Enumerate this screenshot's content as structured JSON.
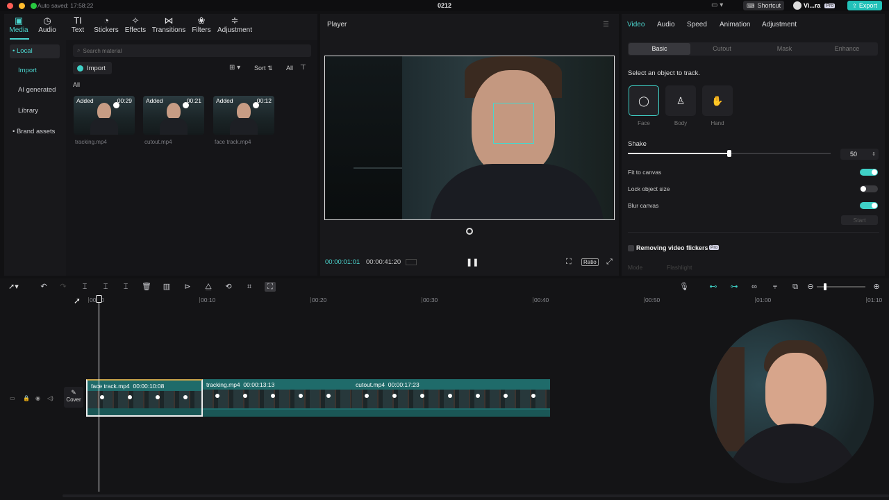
{
  "titlebar": {
    "autosave": "Auto saved: 17:58:22",
    "project": "0212",
    "shortcut": "Shortcut",
    "user": "Vi...ra",
    "pro": "Pro",
    "export": "Export"
  },
  "toolbar": [
    {
      "label": "Media",
      "icon": "▣",
      "name": "media-tab"
    },
    {
      "label": "Audio",
      "icon": "◷",
      "name": "audio-tab"
    },
    {
      "label": "Text",
      "icon": "TI",
      "name": "text-tab"
    },
    {
      "label": "Stickers",
      "icon": "◔",
      "name": "stickers-tab"
    },
    {
      "label": "Effects",
      "icon": "✧",
      "name": "effects-tab"
    },
    {
      "label": "Transitions",
      "icon": "⋈",
      "name": "transitions-tab"
    },
    {
      "label": "Filters",
      "icon": "❀",
      "name": "filters-tab"
    },
    {
      "label": "Adjustment",
      "icon": "≑",
      "name": "adjustment-tab"
    }
  ],
  "sidebar": {
    "local": "• Local",
    "import": "Import",
    "ai": "AI generated",
    "library": "Library",
    "brand": "• Brand assets"
  },
  "media": {
    "search_placeholder": "Search material",
    "import": "Import",
    "sort": "Sort",
    "all": "All",
    "section": "All",
    "items": [
      {
        "tag": "Added",
        "duration": "00:29",
        "name": "tracking.mp4"
      },
      {
        "tag": "Added",
        "duration": "00:21",
        "name": "cutout.mp4"
      },
      {
        "tag": "Added",
        "duration": "00:12",
        "name": "face track.mp4"
      }
    ]
  },
  "player": {
    "title": "Player",
    "current": "00:00:01:01",
    "total": "00:00:41:20",
    "ratio": "Ratio"
  },
  "props": {
    "tabs": [
      "Video",
      "Audio",
      "Speed",
      "Animation",
      "Adjustment"
    ],
    "subtabs": [
      "Basic",
      "Cutout",
      "Mask",
      "Enhance"
    ],
    "select_label": "Select an object to track.",
    "targets": [
      "Face",
      "Body",
      "Hand"
    ],
    "shake_label": "Shake",
    "shake_value": "50",
    "shake_level": 0.5,
    "fit": "Fit to canvas",
    "lock": "Lock object size",
    "blur": "Blur canvas",
    "start": "Start",
    "flicker": "Removing video flickers",
    "flicker_badge": "Pro",
    "mode": "Mode",
    "mode_value": "Flashlight"
  },
  "timeline": {
    "ruler": [
      "00:00",
      "00:10",
      "00:20",
      "00:30",
      "00:40",
      "00:50",
      "01:00",
      "01:10"
    ],
    "cover": "Cover",
    "clips": [
      {
        "name": "face track.mp4",
        "duration": "00:00:10:08"
      },
      {
        "name": "tracking.mp4",
        "duration": "00:00:13:13"
      },
      {
        "name": "cutout.mp4",
        "duration": "00:00:17:23"
      }
    ]
  },
  "colors": {
    "accent": "#3fd1c7",
    "export": "#22c1b8",
    "clip": "#1f6b6a"
  }
}
